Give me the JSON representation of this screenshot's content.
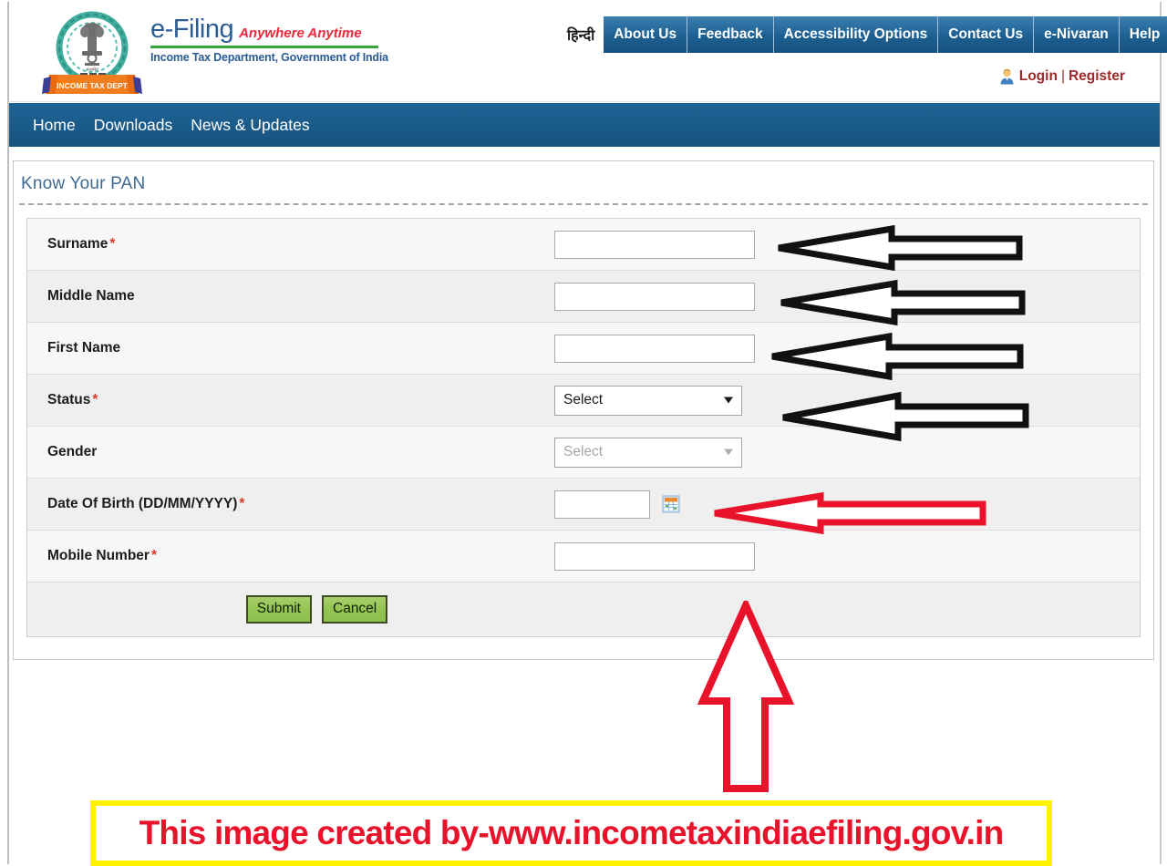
{
  "header": {
    "brand_name": "e-Filing",
    "brand_tagline": "Anywhere Anytime",
    "brand_subtitle": "Income Tax Department, Government of India",
    "emblem_alt": "income-tax-department-emblem",
    "hindi_label": "हिन्दी",
    "top_nav": [
      {
        "label": "About Us"
      },
      {
        "label": "Feedback"
      },
      {
        "label": "Accessibility Options"
      },
      {
        "label": "Contact Us"
      },
      {
        "label": "e-Nivaran"
      },
      {
        "label": "Help"
      }
    ],
    "login_label": "Login",
    "separator": "|",
    "register_label": "Register"
  },
  "main_nav": [
    {
      "label": "Home"
    },
    {
      "label": "Downloads"
    },
    {
      "label": "News & Updates"
    }
  ],
  "panel": {
    "title": "Know Your PAN",
    "required_marker": "*",
    "fields": [
      {
        "label": "Surname",
        "required": true,
        "type": "text",
        "value": ""
      },
      {
        "label": "Middle Name",
        "required": false,
        "type": "text",
        "value": ""
      },
      {
        "label": "First Name",
        "required": false,
        "type": "text",
        "value": ""
      },
      {
        "label": "Status",
        "required": true,
        "type": "select",
        "value": "Select",
        "state": "enabled"
      },
      {
        "label": "Gender",
        "required": false,
        "type": "select",
        "value": "Select",
        "state": "disabled"
      },
      {
        "label": "Date Of Birth (DD/MM/YYYY)",
        "required": true,
        "type": "date",
        "value": ""
      },
      {
        "label": "Mobile Number",
        "required": true,
        "type": "text",
        "value": ""
      }
    ],
    "buttons": {
      "submit_label": "Submit",
      "cancel_label": "Cancel"
    },
    "calendar_icon": "calendar-icon"
  },
  "annotations": {
    "arrow_color_black": "#111111",
    "arrow_color_red": "#e8132b",
    "black_arrows_count": 4,
    "red_left_arrow_count": 1,
    "red_up_arrow_count": 1
  },
  "banner": {
    "text": "This image created by-www.incometaxindiaefiling.gov.in",
    "text_color": "#e8132b",
    "border_color": "#fff200"
  },
  "colors": {
    "nav_blue": "#1a5a88",
    "brand_blue": "#2b5c93",
    "brand_red": "#e8283c",
    "brand_green": "#35a53c",
    "button_green": "#93c455",
    "login_red": "#9c2a28",
    "title_blue": "#3f6a92"
  }
}
